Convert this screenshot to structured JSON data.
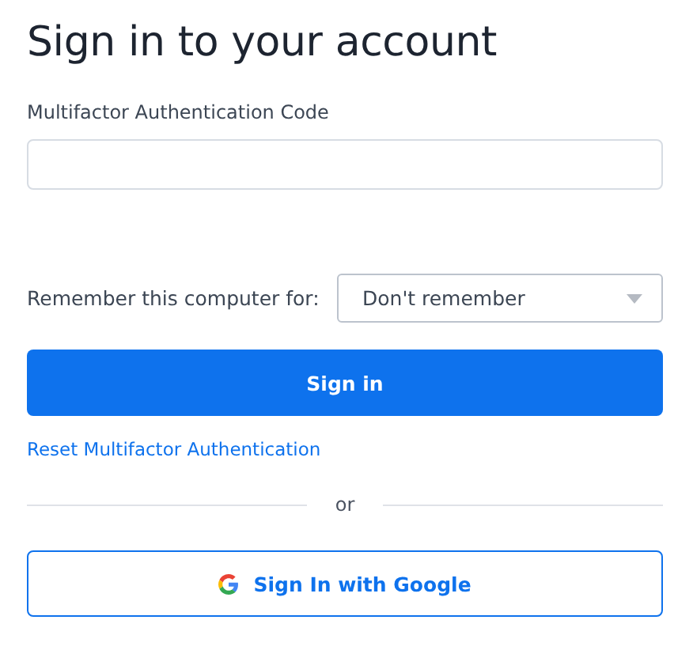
{
  "title": "Sign in to your account",
  "code_field": {
    "label": "Multifactor Authentication Code"
  },
  "remember": {
    "label": "Remember this computer for:",
    "value": "Don't remember"
  },
  "sign_in_button": "Sign in",
  "reset_link": "Reset Multifactor Authentication",
  "divider_text": "or",
  "google_button": "Sign In with Google"
}
